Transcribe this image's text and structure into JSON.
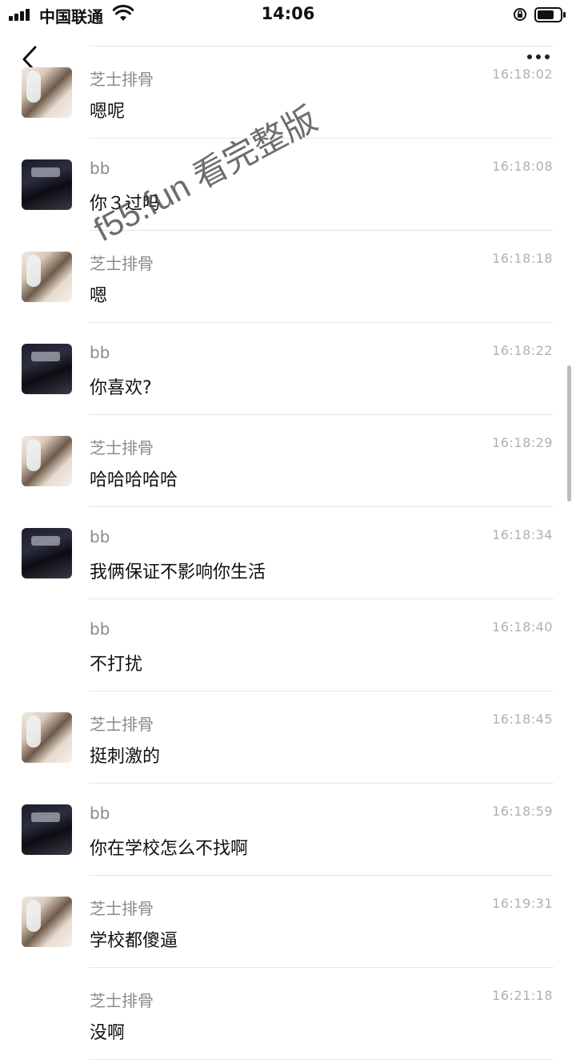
{
  "status_bar": {
    "carrier": "中国联通",
    "time": "14:06"
  },
  "nav": {
    "back_icon": "chevron-left-icon",
    "more_icon": "ellipsis-icon"
  },
  "watermark": {
    "text": "f55.fun 看完整版"
  },
  "messages": [
    {
      "sender": "芝士排骨",
      "time": "16:18:02",
      "text": "嗯呢",
      "avatar": "girl"
    },
    {
      "sender": "bb",
      "time": "16:18:08",
      "text": "你３过吗",
      "avatar": "boy"
    },
    {
      "sender": "芝士排骨",
      "time": "16:18:18",
      "text": "嗯",
      "avatar": "girl"
    },
    {
      "sender": "bb",
      "time": "16:18:22",
      "text": "你喜欢?",
      "avatar": "boy"
    },
    {
      "sender": "芝士排骨",
      "time": "16:18:29",
      "text": "哈哈哈哈哈",
      "avatar": "girl"
    },
    {
      "sender": "bb",
      "time": "16:18:34",
      "text": "我俩保证不影响你生活",
      "avatar": "boy"
    },
    {
      "sender": "bb",
      "time": "16:18:40",
      "text": "不打扰",
      "avatar": "none"
    },
    {
      "sender": "芝士排骨",
      "time": "16:18:45",
      "text": "挺刺激的",
      "avatar": "girl"
    },
    {
      "sender": "bb",
      "time": "16:18:59",
      "text": "你在学校怎么不找啊",
      "avatar": "boy"
    },
    {
      "sender": "芝士排骨",
      "time": "16:19:31",
      "text": "学校都傻逼",
      "avatar": "girl"
    },
    {
      "sender": "芝士排骨",
      "time": "16:21:18",
      "text": "没啊",
      "avatar": "none"
    }
  ]
}
